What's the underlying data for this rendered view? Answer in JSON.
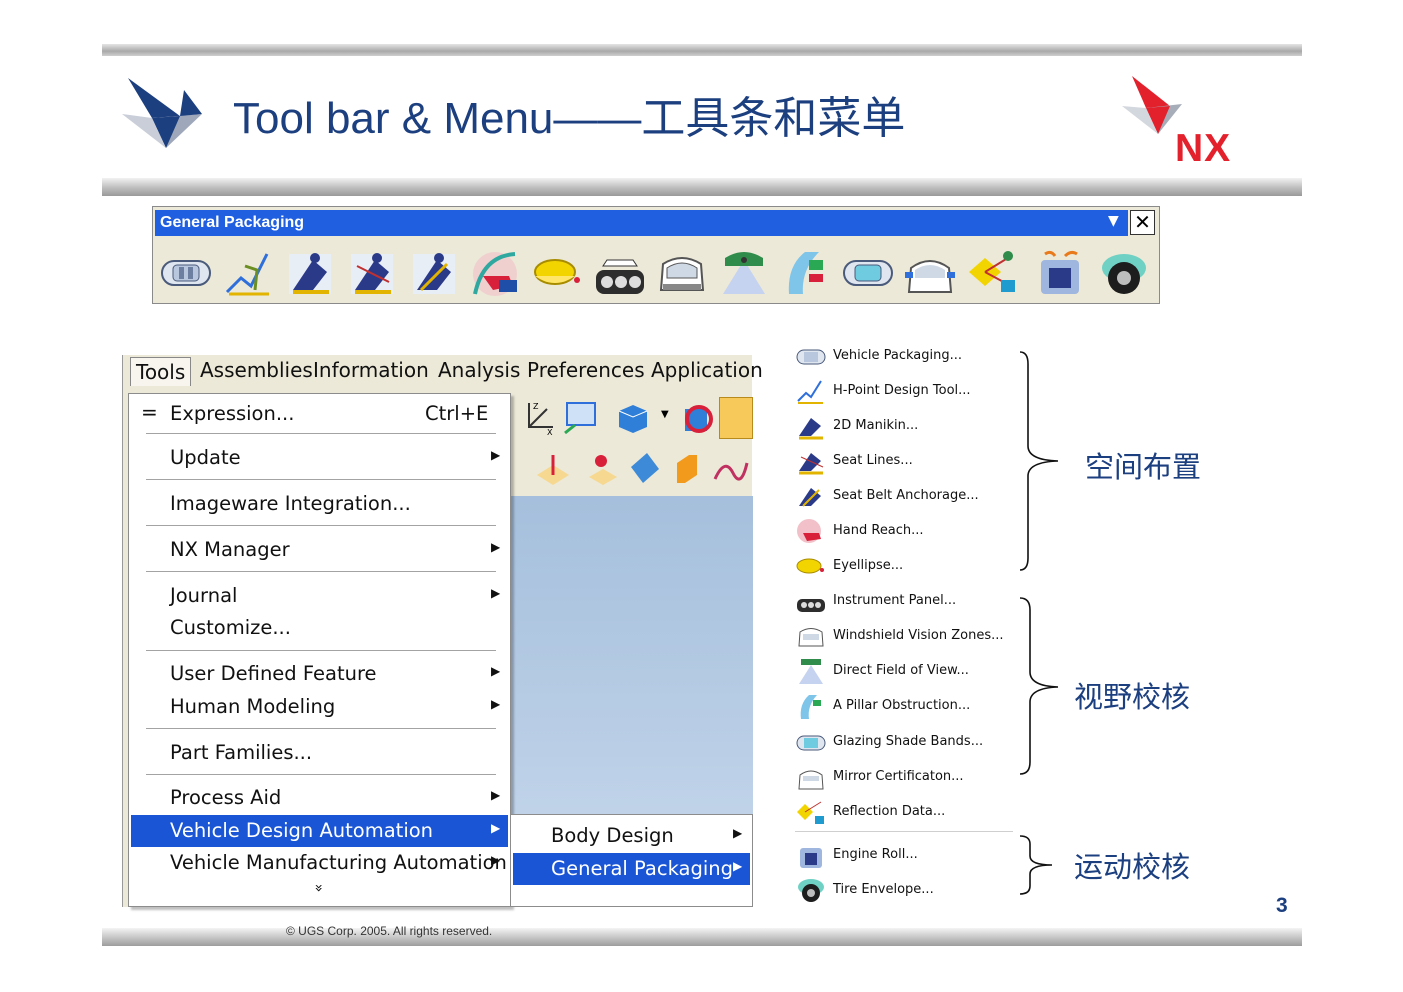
{
  "slide": {
    "title": "Tool bar & Menu——工具条和菜单",
    "logo_text": "NX",
    "copyright": "© UGS Corp. 2005. All rights reserved.",
    "page_number": "3",
    "logo_icon": "nx-arrow-logo",
    "colors": {
      "title": "#1c3f7f",
      "logo_red": "#e2212d",
      "highlight": "#1a55d6"
    }
  },
  "toolbar": {
    "title": "General Packaging",
    "dropdown_icon": "triangle-down-icon",
    "close_icon": "close-icon",
    "tools": [
      "vehicle-packaging-icon",
      "h-point-design-icon",
      "2d-manikin-icon",
      "seat-lines-icon",
      "seat-belt-anchorage-icon",
      "hand-reach-icon",
      "eyellipse-icon",
      "instrument-panel-icon",
      "windshield-vision-icon",
      "direct-field-of-view-icon",
      "a-pillar-obstruction-icon",
      "glazing-shade-bands-icon",
      "mirror-certification-icon",
      "reflection-data-icon",
      "engine-roll-icon",
      "tire-envelope-icon"
    ]
  },
  "menubar": {
    "items": [
      "Tools",
      "Assemblies",
      "Information",
      "Analysis",
      "Preferences",
      "Application"
    ]
  },
  "tools_menu": {
    "expression": {
      "label": "Expression...",
      "shortcut": "Ctrl+E"
    },
    "update": "Update",
    "imageware": "Imageware Integration...",
    "nx_manager": "NX Manager",
    "journal": "Journal",
    "customize": "Customize...",
    "udf": "User Defined Feature",
    "human_modeling": "Human Modeling",
    "part_families": "Part Families...",
    "process_aid": "Process Aid",
    "vda": "Vehicle Design Automation",
    "vma": "Vehicle Manufacturing Automation",
    "more": "»"
  },
  "submenu": {
    "body_design": "Body Design",
    "general_packaging": "General Packaging"
  },
  "tool_list": [
    {
      "label": "Vehicle Packaging...",
      "icon": "vehicle-packaging-icon"
    },
    {
      "label": "H-Point Design Tool...",
      "icon": "h-point-design-icon"
    },
    {
      "label": "2D Manikin...",
      "icon": "2d-manikin-icon"
    },
    {
      "label": "Seat Lines...",
      "icon": "seat-lines-icon"
    },
    {
      "label": "Seat Belt Anchorage...",
      "icon": "seat-belt-anchorage-icon"
    },
    {
      "label": "Hand Reach...",
      "icon": "hand-reach-icon"
    },
    {
      "label": "Eyellipse...",
      "icon": "eyellipse-icon"
    },
    {
      "label": "Instrument Panel...",
      "icon": "instrument-panel-icon"
    },
    {
      "label": "Windshield Vision Zones...",
      "icon": "windshield-vision-icon"
    },
    {
      "label": "Direct Field of View...",
      "icon": "direct-field-of-view-icon"
    },
    {
      "label": "A Pillar Obstruction...",
      "icon": "a-pillar-obstruction-icon"
    },
    {
      "label": "Glazing Shade Bands...",
      "icon": "glazing-shade-bands-icon"
    },
    {
      "label": "Mirror Certificaton...",
      "icon": "mirror-certification-icon"
    },
    {
      "label": "Reflection Data...",
      "icon": "reflection-data-icon"
    },
    {
      "label": "Engine Roll...",
      "icon": "engine-roll-icon"
    },
    {
      "label": "Tire Envelope...",
      "icon": "tire-envelope-icon"
    }
  ],
  "groups": {
    "spatial": "空间布置",
    "vision": "视野校核",
    "motion": "运动校核"
  }
}
